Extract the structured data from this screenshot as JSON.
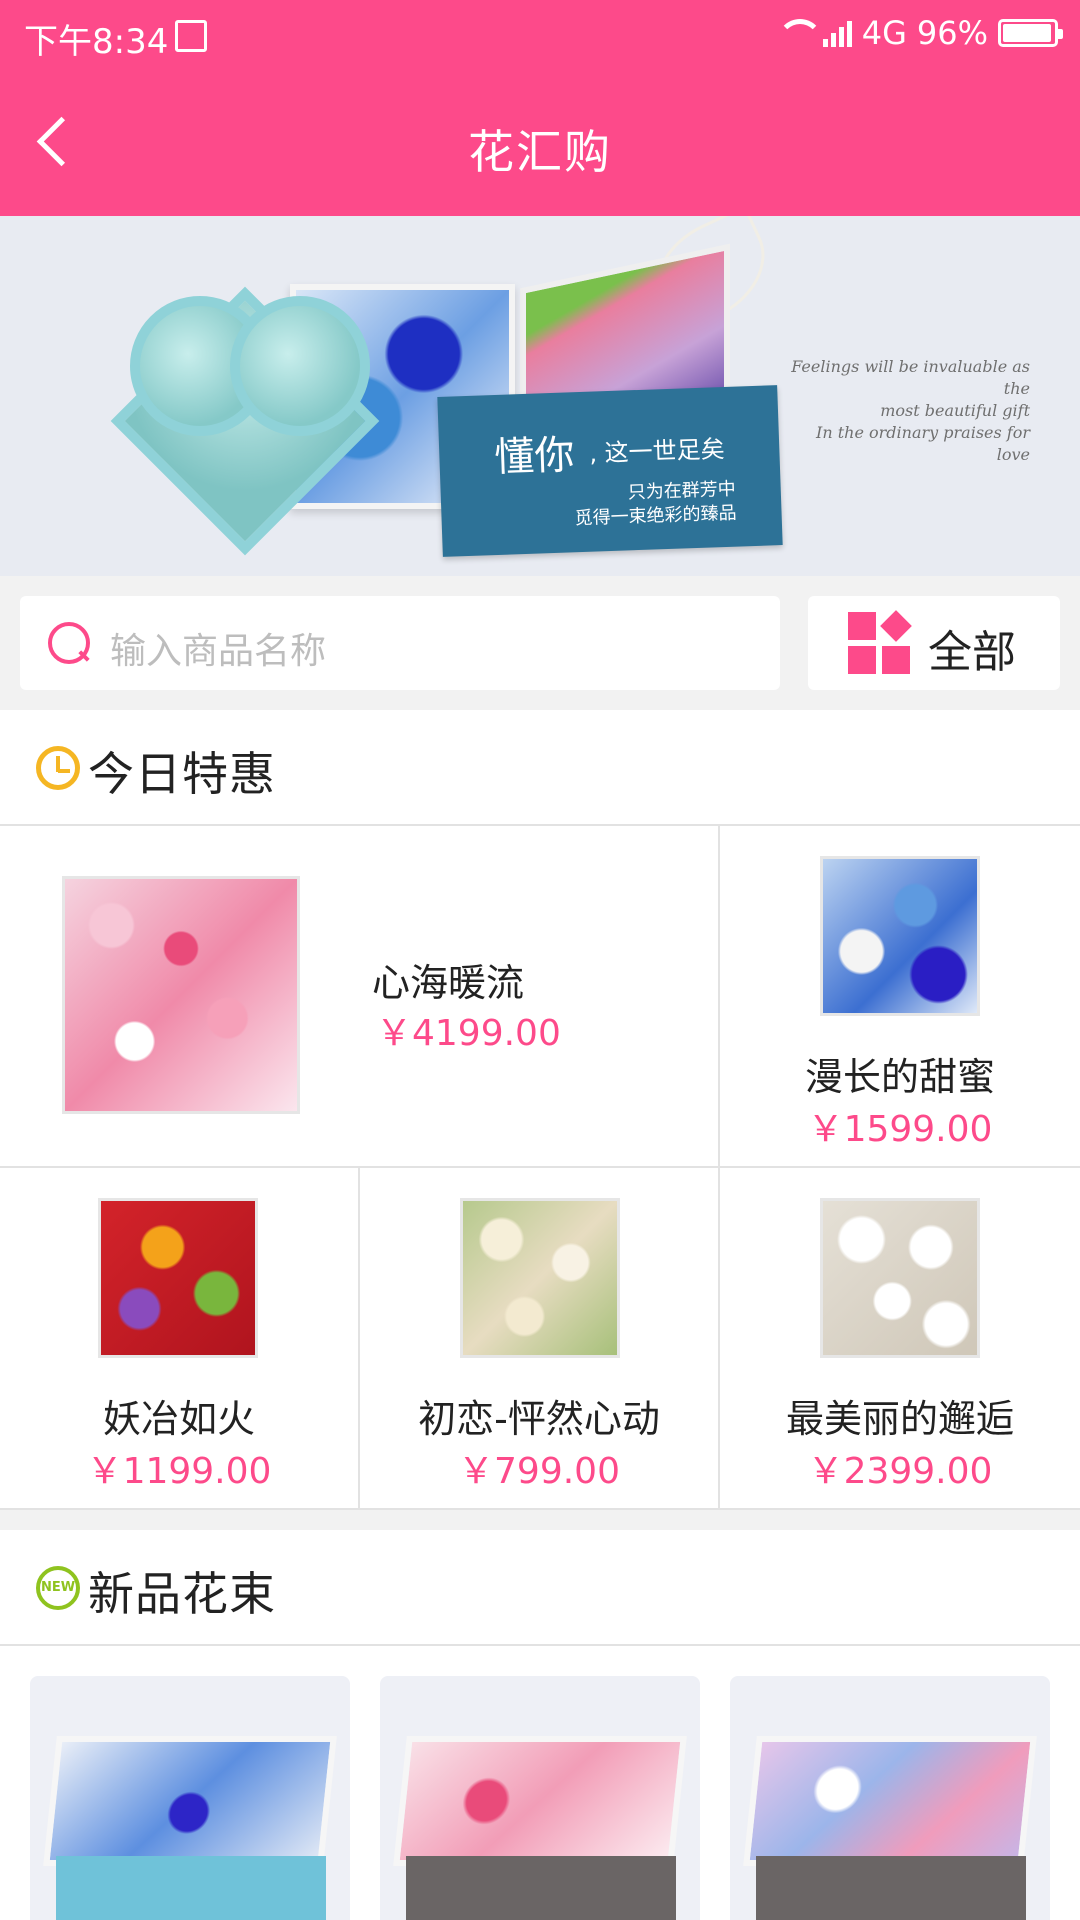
{
  "status_bar": {
    "time": "下午8:34",
    "network": "4G",
    "battery": "96%"
  },
  "header": {
    "title": "花汇购",
    "color": "#fd4a8a"
  },
  "banner": {
    "headline_big": "懂你",
    "headline_small": ", 这一世足矣",
    "line1": "只为在群芳中",
    "line2": "觅得一束绝彩的臻品",
    "script_line1": "Feelings will be invaluable as the",
    "script_line2": "most beautiful gift",
    "script_line3": "In the ordinary praises for love"
  },
  "search": {
    "placeholder": "输入商品名称",
    "all_label": "全部"
  },
  "daily_deals": {
    "title": "今日特惠",
    "items": [
      {
        "name": "心海暖流",
        "price": "￥4199.00"
      },
      {
        "name": "漫长的甜蜜",
        "price": "￥1599.00"
      },
      {
        "name": "妖冶如火",
        "price": "￥1199.00"
      },
      {
        "name": "初恋-怦然心动",
        "price": "￥799.00"
      },
      {
        "name": "最美丽的邂逅",
        "price": "￥2399.00"
      }
    ]
  },
  "new_bouquets": {
    "title": "新品花束",
    "badge": "NEW"
  },
  "colors": {
    "accent": "#fd4a8a",
    "clock": "#f5b623",
    "new_badge": "#8fc31f"
  }
}
